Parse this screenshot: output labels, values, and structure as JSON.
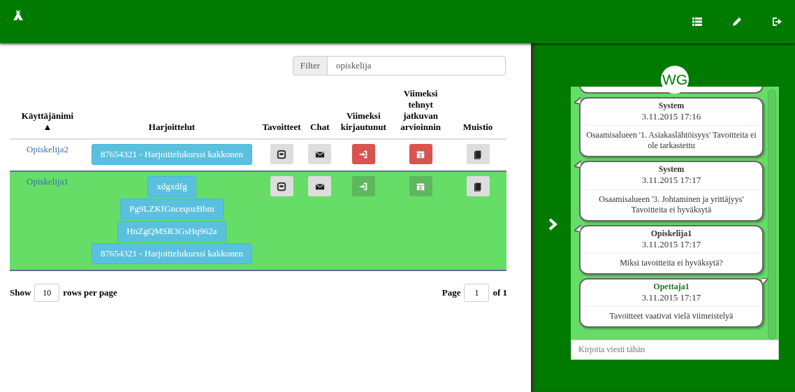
{
  "filter": {
    "label": "Filter",
    "value": "opiskelija"
  },
  "table": {
    "columns": [
      {
        "label": "Käyttäjänimi",
        "sort_mark": "▲"
      },
      {
        "label": "Harjoittelut"
      },
      {
        "label": "Tavoitteet"
      },
      {
        "label": "Chat"
      },
      {
        "label": "Viimeksi kirjautunut"
      },
      {
        "label": "Viimeksi tehnyt jatkuvan arvioinnin"
      },
      {
        "label": "Muistio"
      }
    ],
    "rows": [
      {
        "username": "Opiskelija2",
        "selected": false,
        "courses": [
          "87654321 - Harjoittelukurssi kakkonen"
        ],
        "login_ok": false,
        "assessment_ok": false
      },
      {
        "username": "Opiskelija1",
        "selected": true,
        "courses": [
          "xdgxdfg",
          "Pg9LZKfGnceqozBbm",
          "HnZgQMSR3GsHq962a",
          "87654321 - Harjoittelukurssi kakkonen"
        ],
        "login_ok": true,
        "assessment_ok": true
      }
    ]
  },
  "pagination": {
    "show_label": "Show",
    "rows_value": "10",
    "rows_label": "rows per page",
    "page_label": "Page",
    "page_value": "1",
    "of_label": "of 1"
  },
  "chat": {
    "avatar": "WG",
    "input": {
      "placeholder": "Kirjoita viesti tähän"
    },
    "messages": [
      {
        "kind": "incoming",
        "author": "System",
        "time": "3.11.2015 17:16",
        "text": "Osaamisalueen '1. Asiakaslähtöisyys' Tavoitteita ei ole tarkastettu"
      },
      {
        "kind": "incoming",
        "author": "System",
        "time": "3.11.2015 17:17",
        "text": "Osaamisalueen '3. Johtaminen ja yrittäjyys' Tavoitteita ei hyväksytä"
      },
      {
        "kind": "incoming",
        "author": "Opiskelija1",
        "time": "3.11.2015 17:17",
        "text": "Miksi tavoitteita ei hyväksytä?"
      },
      {
        "kind": "outgoing",
        "author": "Opettaja1",
        "time": "3.11.2015 17:17",
        "text": "Tavoitteet vaativat vielä viimeistelyä"
      }
    ]
  }
}
